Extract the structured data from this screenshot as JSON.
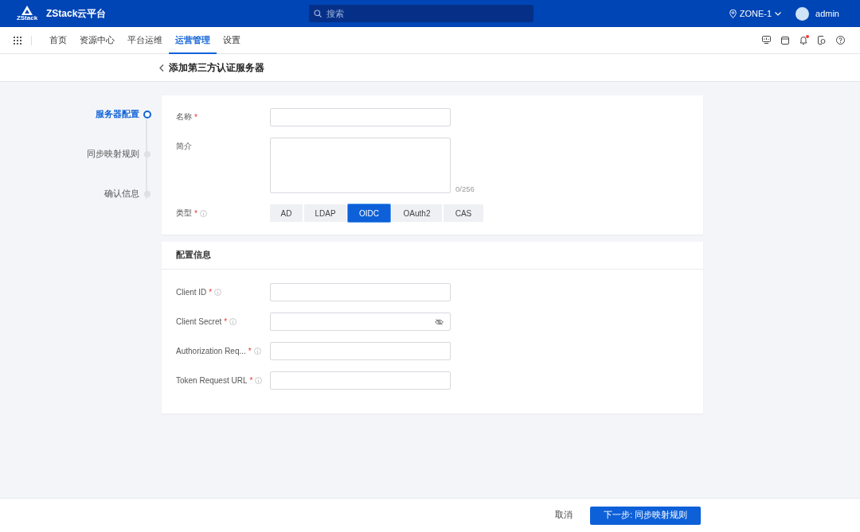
{
  "header": {
    "logo_text": "ZStack",
    "brand": "ZStack云平台",
    "search_placeholder": "搜索",
    "zone": "ZONE-1",
    "user": "admin"
  },
  "nav": {
    "items": [
      {
        "label": "首页",
        "selected": false
      },
      {
        "label": "资源中心",
        "selected": false
      },
      {
        "label": "平台运维",
        "selected": false
      },
      {
        "label": "运营管理",
        "selected": true
      },
      {
        "label": "设置",
        "selected": false
      }
    ],
    "notification_unread": true
  },
  "page_title": "添加第三方认证服务器",
  "steps": [
    {
      "label": "服务器配置",
      "selected": true
    },
    {
      "label": "同步映射规则",
      "selected": false
    },
    {
      "label": "确认信息",
      "selected": false
    }
  ],
  "basic": {
    "fields": [
      {
        "kind": "text",
        "label": "名称",
        "required_mark": "*"
      },
      {
        "kind": "textarea",
        "label": "简介",
        "counter": "0/256"
      },
      {
        "kind": "segmented",
        "label": "类型",
        "required_mark": "*",
        "info": true,
        "options": [
          {
            "label": "AD",
            "selected": false
          },
          {
            "label": "LDAP",
            "selected": false
          },
          {
            "label": "OIDC",
            "selected": true
          },
          {
            "label": "OAuth2",
            "selected": false
          },
          {
            "label": "CAS",
            "selected": false
          }
        ]
      }
    ]
  },
  "config": {
    "title": "配置信息",
    "fields": [
      {
        "kind": "text",
        "label": "Client ID",
        "required_mark": "*",
        "info": true
      },
      {
        "kind": "password",
        "label": "Client Secret",
        "required_mark": "*",
        "info": true
      },
      {
        "kind": "text",
        "label": "Authorization Req...",
        "required_mark": "*",
        "info": true
      },
      {
        "kind": "text",
        "label": "Token Request URL",
        "required_mark": "*",
        "info": true
      }
    ]
  },
  "footer": {
    "cancel": "取消",
    "next": "下一步: 同步映射规则"
  }
}
